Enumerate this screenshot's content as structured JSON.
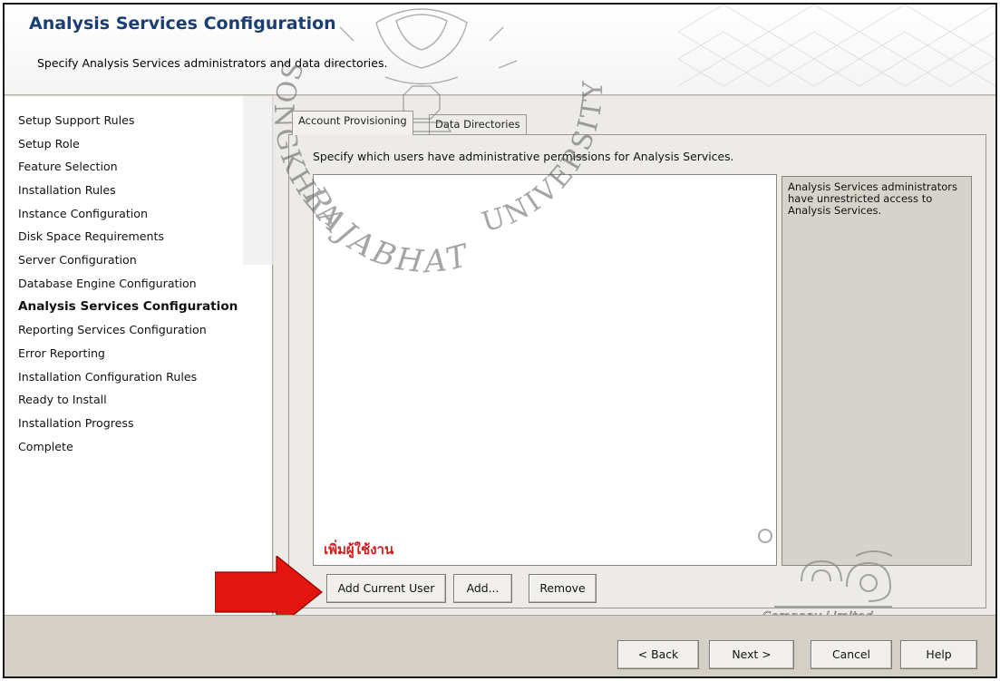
{
  "header": {
    "title": "Analysis Services Configuration",
    "subtitle": "Specify Analysis Services administrators and data directories."
  },
  "watermark": {
    "left_text": "SONGKHLA",
    "bottom_text": "RAJABHAT",
    "right_text": "UNIVERSITY"
  },
  "nav": {
    "items": [
      "Setup Support Rules",
      "Setup Role",
      "Feature Selection",
      "Installation Rules",
      "Instance Configuration",
      "Disk Space Requirements",
      "Server Configuration",
      "Database Engine Configuration",
      "Analysis Services Configuration",
      "Reporting Services Configuration",
      "Error Reporting",
      "Installation Configuration Rules",
      "Ready to Install",
      "Installation Progress",
      "Complete"
    ],
    "active_index": 8
  },
  "tabs": [
    {
      "label": "Account Provisioning",
      "active": true
    },
    {
      "label": "Data Directories",
      "active": false
    }
  ],
  "panel": {
    "caption": "Specify which users have administrative permissions for Analysis Services.",
    "info_text": "Analysis Services administrators have unrestricted access to Analysis Services.",
    "annotation_thai": "เพิ่มผู้ใช้งาน",
    "buttons": {
      "add_current_user": "Add Current User",
      "add": "Add...",
      "remove": "Remove"
    }
  },
  "logo": {
    "text": "Company Limited"
  },
  "footer": {
    "back": "< Back",
    "next": "Next >",
    "cancel": "Cancel",
    "help": "Help"
  },
  "colors": {
    "title": "#1a3e74",
    "annotation": "#d51a1a",
    "arrow": "#e3150f"
  }
}
